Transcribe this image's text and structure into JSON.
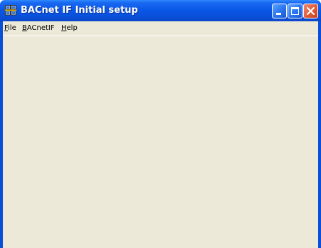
{
  "window": {
    "title": "BACnet IF Initial setup",
    "icon": "network-computers-icon"
  },
  "title_buttons": [
    {
      "name": "minimize-icon"
    },
    {
      "name": "maximize-icon"
    },
    {
      "name": "close-icon"
    }
  ],
  "menu": {
    "file": {
      "mnemonic": "F",
      "rest": "ile"
    },
    "bacnetif": {
      "mnemonic": "B",
      "rest": "ACnetIF"
    },
    "help": {
      "mnemonic": "H",
      "rest": "elp"
    }
  },
  "colors": {
    "titlebar": "#0a58e6",
    "client_background": "#ece9d8",
    "close_button": "#e05a38"
  }
}
